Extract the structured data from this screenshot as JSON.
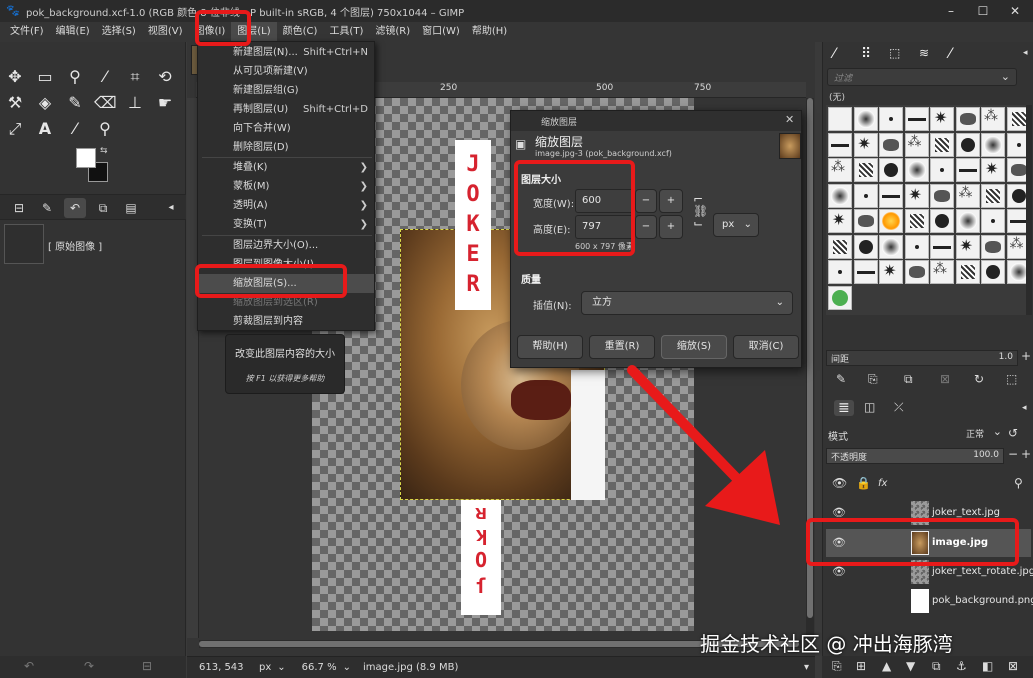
{
  "window": {
    "title": "pok_background.xcf-1.0 (RGB 颜色 8 位非线性整数, GIMP built-in sRGB, 4 个图层) 750x1044 – GIMP",
    "title_visible": "pok_background.xcf-1.0 (RGB 颜色 8 位非线",
    "title_tail": "P built-in sRGB, 4 个图层) 750x1044 – GIMP",
    "controls": [
      "–",
      "☐",
      "✕"
    ]
  },
  "menubar": [
    "文件(F)",
    "编辑(E)",
    "选择(S)",
    "视图(V)",
    "图像(I)",
    "图层(L)",
    "颜色(C)",
    "工具(T)",
    "滤镜(R)",
    "窗口(W)",
    "帮助(H)"
  ],
  "layer_menu": {
    "items": [
      {
        "label": "新建图层(N)...",
        "shortcut": "Shift+Ctrl+N"
      },
      {
        "label": "从可见项新建(V)",
        "shortcut": ""
      },
      {
        "label": "新建图层组(G)",
        "shortcut": ""
      },
      {
        "label": "再制图层(U)",
        "shortcut": "Shift+Ctrl+D"
      },
      {
        "label": "向下合并(W)",
        "shortcut": ""
      },
      {
        "label": "删除图层(D)",
        "shortcut": ""
      },
      {
        "label": "堆叠(K)",
        "submenu": true
      },
      {
        "label": "蒙板(M)",
        "submenu": true
      },
      {
        "label": "透明(A)",
        "submenu": true
      },
      {
        "label": "变换(T)",
        "submenu": true
      },
      {
        "label": "图层边界大小(O)...",
        "shortcut": ""
      },
      {
        "label": "图层到图像大小(I)",
        "shortcut": ""
      },
      {
        "label": "缩放图层(S)...",
        "shortcut": "",
        "highlighted": true
      },
      {
        "label": "缩放图层到选区(R)",
        "shortcut": "",
        "disabled": true
      },
      {
        "label": "剪裁图层到内容",
        "shortcut": ""
      }
    ]
  },
  "tooltip": {
    "line1": "改变此图层内容的大小",
    "line2": "按 F1 以获得更多帮助"
  },
  "left_dock": {
    "image_tab_label": "[ 原始图像 ]"
  },
  "ruler": {
    "marks": [
      "250",
      "500",
      "750"
    ]
  },
  "canvas": {
    "joker_top": [
      "J",
      "O",
      "K",
      "E",
      "R"
    ],
    "joker_bottom": [
      "ᴚ",
      "ʞ",
      "O",
      "ſ"
    ]
  },
  "dialog": {
    "window_title": "缩放图层",
    "heading": "缩放图层",
    "subtitle": "image.jpg-3 (pok_background.xcf)",
    "section_size": "图层大小",
    "width_label": "宽度(W):",
    "width_value": "600",
    "height_label": "高度(E):",
    "height_value": "797",
    "size_info": "600 x 797 像素",
    "unit": "px",
    "section_quality": "质量",
    "interp_label": "插值(N):",
    "interp_value": "立方",
    "buttons": {
      "help": "帮助(H)",
      "reset": "重置(R)",
      "scale": "缩放(S)",
      "cancel": "取消(C)"
    }
  },
  "right_dock": {
    "filter_placeholder": "过滤",
    "none_label": "(无)",
    "spacing_label": "间距",
    "spacing_value": "1.0",
    "mode_label": "模式",
    "mode_value": "正常",
    "opacity_label": "不透明度",
    "opacity_value": "100.0",
    "layers": [
      {
        "name": "joker_text.jpg"
      },
      {
        "name": "image.jpg",
        "selected": true
      },
      {
        "name": "joker_text_rotate.jpg"
      },
      {
        "name": "pok_background.png"
      }
    ]
  },
  "statusbar": {
    "coords": "613, 543",
    "unit": "px",
    "zoom": "66.7 %",
    "layer_info": "image.jpg (8.9 MB)"
  },
  "watermark": "掘金技术社区 @ 冲出海豚湾",
  "colors": {
    "annotation_red": "#e81a1a",
    "joker_red": "#d6232f",
    "fg_color": "#ffffff",
    "bg_color": "#111111"
  }
}
